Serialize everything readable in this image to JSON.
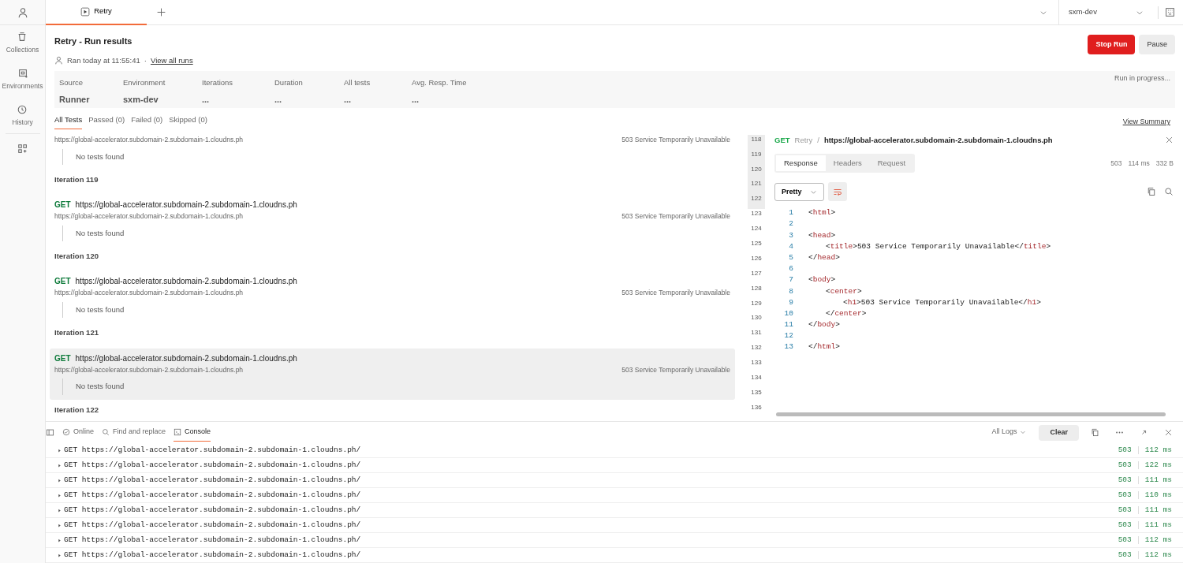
{
  "sidebar": {
    "items": [
      {
        "label": "Collections"
      },
      {
        "label": "Environments"
      },
      {
        "label": "History"
      }
    ]
  },
  "tabs": [
    {
      "label": "Retry",
      "selected": true
    }
  ],
  "environment_select": {
    "value": "sxm-dev"
  },
  "header": {
    "title": "Retry - Run results",
    "ran": "Ran today at 11:55:41",
    "separator": "·",
    "view_all_runs": "View all runs",
    "buttons": [
      {
        "label": "Stop Run",
        "kind": "danger"
      },
      {
        "label": "Pause",
        "kind": "secondary"
      }
    ]
  },
  "summary": {
    "fields": [
      {
        "label": "Source",
        "value": "Runner"
      },
      {
        "label": "Environment",
        "value": "sxm-dev"
      },
      {
        "label": "Iterations",
        "value": "..."
      },
      {
        "label": "Duration",
        "value": "..."
      },
      {
        "label": "All tests",
        "value": "..."
      },
      {
        "label": "Avg. Resp. Time",
        "value": "..."
      }
    ],
    "status": "Run in progress..."
  },
  "filter_tabs": [
    {
      "label": "All Tests",
      "selected": true
    },
    {
      "label": "Passed (0)",
      "selected": false
    },
    {
      "label": "Failed (0)",
      "selected": false
    },
    {
      "label": "Skipped (0)",
      "selected": false
    }
  ],
  "view_summary": "View Summary",
  "results": [
    {
      "kind": "request",
      "url": "https://global-accelerator.subdomain-2.subdomain-1.cloudns.ph",
      "status": "503 Service Temporarily Unavailable",
      "tests": "No tests found",
      "highlighted": false
    },
    {
      "kind": "iteration",
      "label": "Iteration 119"
    },
    {
      "kind": "request",
      "method": "GET",
      "title": "https://global-accelerator.subdomain-2.subdomain-1.cloudns.ph",
      "url": "https://global-accelerator.subdomain-2.subdomain-1.cloudns.ph",
      "status": "503 Service Temporarily Unavailable",
      "tests": "No tests found",
      "highlighted": false
    },
    {
      "kind": "iteration",
      "label": "Iteration 120"
    },
    {
      "kind": "request",
      "method": "GET",
      "title": "https://global-accelerator.subdomain-2.subdomain-1.cloudns.ph",
      "url": "https://global-accelerator.subdomain-2.subdomain-1.cloudns.ph",
      "status": "503 Service Temporarily Unavailable",
      "tests": "No tests found",
      "highlighted": false
    },
    {
      "kind": "iteration",
      "label": "Iteration 121"
    },
    {
      "kind": "request",
      "method": "GET",
      "title": "https://global-accelerator.subdomain-2.subdomain-1.cloudns.ph",
      "url": "https://global-accelerator.subdomain-2.subdomain-1.cloudns.ph",
      "status": "503 Service Temporarily Unavailable",
      "tests": "No tests found",
      "highlighted": true
    },
    {
      "kind": "iteration",
      "label": "Iteration 122"
    }
  ],
  "gutter_lines": [
    {
      "number": "118",
      "shaded": true
    },
    {
      "number": "119",
      "shaded": true
    },
    {
      "number": "120",
      "shaded": true
    },
    {
      "number": "121",
      "shaded": true
    },
    {
      "number": "122",
      "shaded": true
    },
    {
      "number": "123",
      "shaded": false
    },
    {
      "number": "124",
      "shaded": false
    },
    {
      "number": "125",
      "shaded": false
    },
    {
      "number": "126",
      "shaded": false
    },
    {
      "number": "127",
      "shaded": false
    },
    {
      "number": "128",
      "shaded": false
    },
    {
      "number": "129",
      "shaded": false
    },
    {
      "number": "130",
      "shaded": false
    },
    {
      "number": "131",
      "shaded": false
    },
    {
      "number": "132",
      "shaded": false
    },
    {
      "number": "133",
      "shaded": false
    },
    {
      "number": "134",
      "shaded": false
    },
    {
      "number": "135",
      "shaded": false
    },
    {
      "number": "136",
      "shaded": false
    }
  ],
  "detail": {
    "method": "GET",
    "collection": "Retry",
    "separator": "/",
    "url": "https://global-accelerator.subdomain-2.subdomain-1.cloudns.ph",
    "tabs": [
      {
        "label": "Response",
        "selected": true
      },
      {
        "label": "Headers",
        "selected": false
      },
      {
        "label": "Request",
        "selected": false
      }
    ],
    "status": "503",
    "time": "114 ms",
    "size": "332 B",
    "format": "Pretty",
    "code": [
      {
        "number": "1",
        "text": "<html>"
      },
      {
        "number": "2"
      },
      {
        "number": "3",
        "text": "<head>",
        "children": [
          {
            "number": "4",
            "text": "<title>503 Service Temporarily Unavailable</title>"
          }
        ]
      },
      {
        "number": "5",
        "text": "</head>"
      },
      {
        "number": "6"
      },
      {
        "number": "7",
        "text": "<body>",
        "children": [
          {
            "number": "8",
            "text": "<center>",
            "children": [
              {
                "number": "9",
                "text": "<h1>503 Service Temporarily Unavailable</h1>"
              }
            ]
          },
          {
            "number": "10",
            "text": "</center>"
          }
        ]
      },
      {
        "number": "11",
        "text": "</body>"
      },
      {
        "number": "12"
      },
      {
        "number": "13",
        "text": "</html>"
      }
    ]
  },
  "bottom_bar": {
    "items": [
      {
        "label": "Online",
        "selected": false
      },
      {
        "label": "Find and replace",
        "selected": false
      },
      {
        "label": "Console",
        "selected": true
      }
    ],
    "log_filter": "All Logs",
    "clear": "Clear"
  },
  "console": [
    {
      "method": "GET",
      "url": "https://global-accelerator.subdomain-2.subdomain-1.cloudns.ph/",
      "status": "503",
      "time": "112 ms"
    },
    {
      "method": "GET",
      "url": "https://global-accelerator.subdomain-2.subdomain-1.cloudns.ph/",
      "status": "503",
      "time": "122 ms"
    },
    {
      "method": "GET",
      "url": "https://global-accelerator.subdomain-2.subdomain-1.cloudns.ph/",
      "status": "503",
      "time": "111 ms"
    },
    {
      "method": "GET",
      "url": "https://global-accelerator.subdomain-2.subdomain-1.cloudns.ph/",
      "status": "503",
      "time": "110 ms"
    },
    {
      "method": "GET",
      "url": "https://global-accelerator.subdomain-2.subdomain-1.cloudns.ph/",
      "status": "503",
      "time": "111 ms"
    },
    {
      "method": "GET",
      "url": "https://global-accelerator.subdomain-2.subdomain-1.cloudns.ph/",
      "status": "503",
      "time": "111 ms"
    },
    {
      "method": "GET",
      "url": "https://global-accelerator.subdomain-2.subdomain-1.cloudns.ph/",
      "status": "503",
      "time": "112 ms"
    },
    {
      "method": "GET",
      "url": "https://global-accelerator.subdomain-2.subdomain-1.cloudns.ph/",
      "status": "503",
      "time": "112 ms"
    }
  ]
}
